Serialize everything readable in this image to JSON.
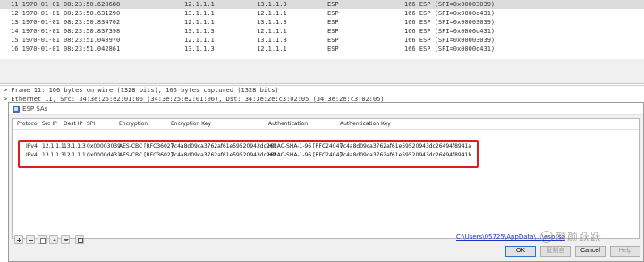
{
  "packet_list": {
    "rows": [
      {
        "no_time": "11 1970-01-01 08:23:50.628688",
        "src": "12.1.1.1",
        "dst": "13.1.1.3",
        "proto": "ESP",
        "info": "166 ESP (SPI=0x00003039)"
      },
      {
        "no_time": "12 1970-01-01 08:23:50.631290",
        "src": "13.1.1.1",
        "dst": "12.1.1.1",
        "proto": "ESP",
        "info": "166 ESP (SPI=0x0000d431)"
      },
      {
        "no_time": "13 1970-01-01 08:23:50.834702",
        "src": "12.1.1.1",
        "dst": "13.1.1.3",
        "proto": "ESP",
        "info": "166 ESP (SPI=0x00003039)"
      },
      {
        "no_time": "14 1970-01-01 08:23:50.837398",
        "src": "13.1.1.3",
        "dst": "12.1.1.1",
        "proto": "ESP",
        "info": "166 ESP (SPI=0x0000d431)"
      },
      {
        "no_time": "15 1970-01-01 08:23:51.040970",
        "src": "12.1.1.1",
        "dst": "13.1.1.3",
        "proto": "ESP",
        "info": "166 ESP (SPI=0x00003039)"
      },
      {
        "no_time": "16 1970-01-01 08:23:51.042861",
        "src": "13.1.1.3",
        "dst": "12.1.1.1",
        "proto": "ESP",
        "info": "166 ESP (SPI=0x0000d431)"
      }
    ]
  },
  "detail": {
    "frame_line": "> Frame 11: 166 bytes on wire (1328 bits), 166 bytes captured (1328 bits)",
    "ethernet_line": "> Ethernet II, Src: 34:3e:25:e2:01:06 (34:3e:25:e2:01:06), Dst: 34:3e:2e:c3:02:05 (34:3e:2e:c3:02:05)"
  },
  "dialog": {
    "title": "ESP SAs",
    "columns": {
      "protocol": "Protocol",
      "src_ip": "Src IP",
      "dest_ip": "Dest IP",
      "spi": "SPI",
      "encryption": "Encryption",
      "encryption_key": "Encryption Key",
      "authentication": "Authentication",
      "authentication_key": "Authentication Key"
    },
    "rows": [
      {
        "protocol": "IPv4",
        "src_ip": "12.1.1.1",
        "dest_ip": "13.1.1.3",
        "spi": "0x00003039",
        "encryption": "AES-CBC [RFC3602]",
        "encryption_key": "7c4a8d09ca3762af61e59520943dc261",
        "authentication": "HMAC-SHA-1-96 [RFC2404]",
        "authentication_key": "7c4a8d09ca3762af61e59520943dc26494f8941a"
      },
      {
        "protocol": "IPv4",
        "src_ip": "13.1.1.3",
        "dest_ip": "12.1.1.1",
        "spi": "0x0000d431",
        "encryption": "AES-CBC [RFC3602]",
        "encryption_key": "7c4a8d09ca3762af61e59520943dc262",
        "authentication": "HMAC-SHA-1-96 [RFC2404]",
        "authentication_key": "7c4a8d09ca3762af61e59520943dc26494f8941b"
      }
    ],
    "path_link": "C:\\Users\\05725\\AppData\\...\\esp_sa",
    "watermark": "颜颜跃跃",
    "buttons": {
      "ok": "OK",
      "copy": "复制自",
      "cancel": "Cancel",
      "help": "Help"
    },
    "toolbar_icons": [
      "plus-icon",
      "minus-icon",
      "copy-icon",
      "up-arrow-icon",
      "down-arrow-icon",
      "clear-icon"
    ]
  },
  "colors": {
    "highlight": "#e31b1b",
    "link": "#1a36c9",
    "default_button_border": "#2a72d0"
  }
}
